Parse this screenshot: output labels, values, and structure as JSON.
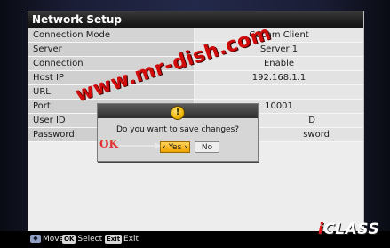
{
  "window": {
    "title": "Network Setup"
  },
  "settings": [
    {
      "label": "Connection Mode",
      "value": "CCcam Client"
    },
    {
      "label": "Server",
      "value": "Server 1"
    },
    {
      "label": "Connection",
      "value": "Enable"
    },
    {
      "label": "Host IP",
      "value": "192.168.1.1"
    },
    {
      "label": "URL",
      "value": ""
    },
    {
      "label": "Port",
      "value": "10001"
    },
    {
      "label": "User ID",
      "value": "D"
    },
    {
      "label": "Password",
      "value": "sword"
    }
  ],
  "dialog": {
    "icon": "exclamation-icon",
    "icon_glyph": "!",
    "question": "Do you want to save changes?",
    "yes_label": "‹ Yes ›",
    "no_label": "No",
    "selected": "Yes"
  },
  "overlay": {
    "watermark": "www.mr-dish.com",
    "ok_note": "OK"
  },
  "footer": {
    "move_label": "Move",
    "select_key": "OK",
    "select_label": "Select",
    "exit_key": "Exit",
    "exit_label": "Exit"
  },
  "brand": {
    "logo_i": "i",
    "logo_rest": "CLASS"
  },
  "colors": {
    "accent": "#f0a400",
    "watermark": "#d10a0a",
    "title_bar": "#222222"
  }
}
